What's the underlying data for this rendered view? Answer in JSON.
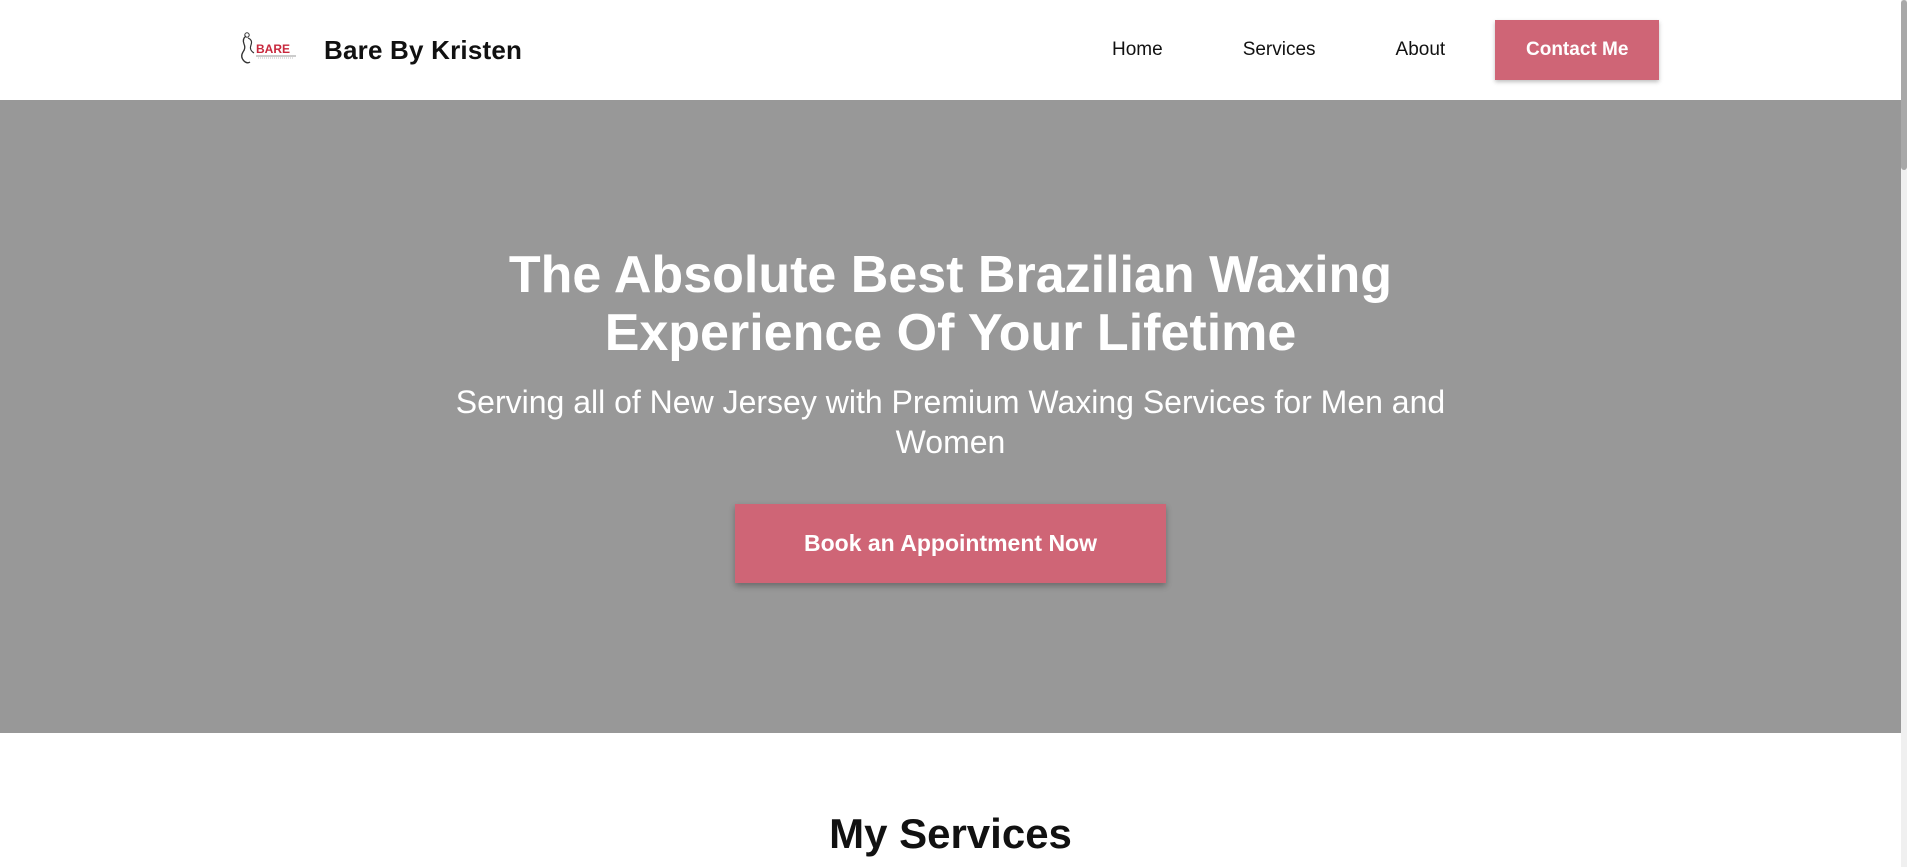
{
  "header": {
    "brand_name": "Bare By Kristen",
    "logo_text": "BARE"
  },
  "nav": {
    "items": [
      "Home",
      "Services",
      "About"
    ],
    "contact_label": "Contact Me"
  },
  "hero": {
    "title_line1": "The Absolute Best Brazilian Waxing",
    "title_line2": "Experience Of Your Lifetime",
    "subtitle": "Serving all of New Jersey with Premium Waxing Services for Men and Women",
    "cta_label": "Book an Appointment Now",
    "background_color": "#989898"
  },
  "services": {
    "heading": "My Services"
  },
  "colors": {
    "accent": "#cf6576",
    "text": "#111111"
  }
}
